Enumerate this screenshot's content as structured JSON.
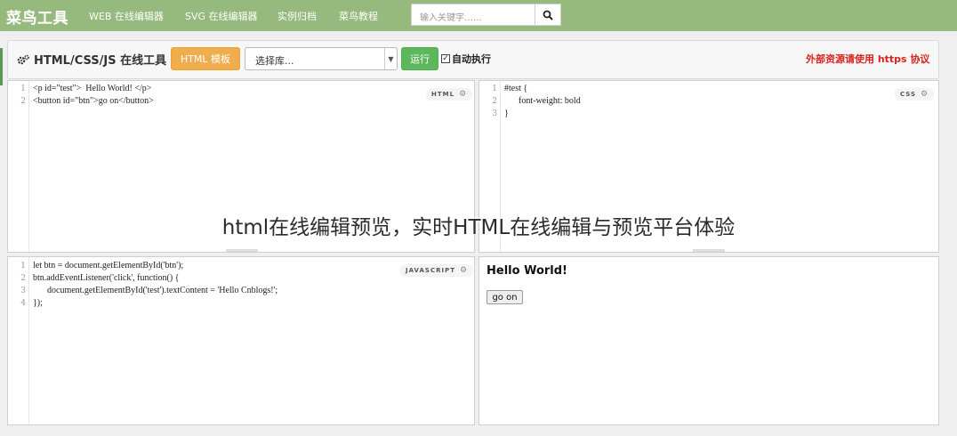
{
  "nav": {
    "logo": "菜鸟工具",
    "links": [
      "WEB 在线编辑器",
      "SVG 在线编辑器",
      "实例归档",
      "菜鸟教程"
    ],
    "search_placeholder": "输入关键字……",
    "search_icon": "search-icon"
  },
  "toolbar": {
    "title": "HTML/CSS/JS 在线工具",
    "title_icon": "gears-icon",
    "template_button": "HTML 模板",
    "library_select": "选择库...",
    "run_button": "运行",
    "autorun_label": "自动执行",
    "autorun_checked": "☑",
    "https_note": "外部资源请使用 https 协议"
  },
  "html_panel": {
    "tag": "HTML",
    "lines": [
      {
        "no": "1",
        "text": "<p id=\"test\">  Hello World! </p>"
      },
      {
        "no": "2",
        "text": "<button id=\"btn\">go on</button>"
      }
    ]
  },
  "css_panel": {
    "tag": "CSS",
    "lines": [
      {
        "no": "1",
        "text": "#test {"
      },
      {
        "no": "2",
        "text": "font-weight: bold"
      },
      {
        "no": "3",
        "text": "}"
      }
    ]
  },
  "js_panel": {
    "tag": "JAVASCRIPT",
    "lines": [
      {
        "no": "1",
        "text": "let btn = document.getElementById('btn');"
      },
      {
        "no": "2",
        "text": "btn.addEventListener('click', function() {"
      },
      {
        "no": "3",
        "text": "document.getElementById('test').textContent = 'Hello Cnblogs!';"
      },
      {
        "no": "4",
        "text": "});"
      }
    ]
  },
  "preview": {
    "heading": "Hello World!",
    "button": "go on"
  },
  "caption": "html在线编辑预览，实时HTML在线编辑与预览平台体验",
  "colors": {
    "nav_bg": "#96b97d",
    "template_btn": "#f0ad4e",
    "run_btn": "#5cb85c",
    "https_note": "#d9231b"
  }
}
